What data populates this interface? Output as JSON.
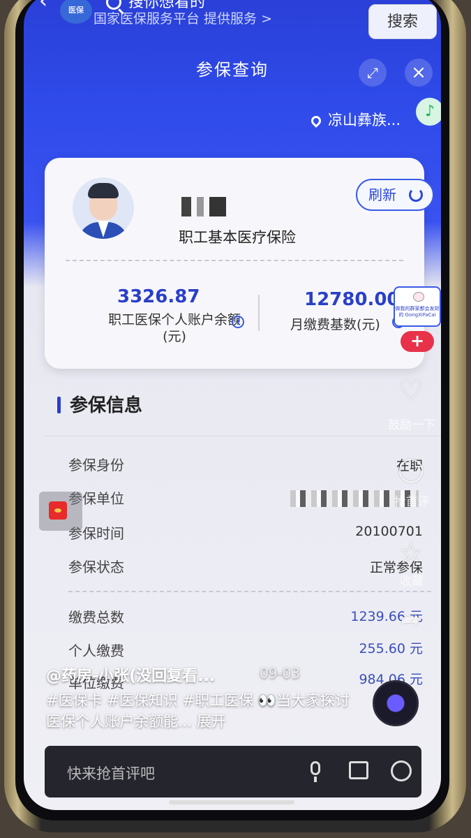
{
  "topbar": {
    "search_placeholder": "搜你想看的",
    "service_text": "国家医保服务平台 提供服务 >",
    "search_button": "搜索",
    "logo_text": "医保"
  },
  "mini_program": {
    "title": "参保查询",
    "location": "凉山彝族..."
  },
  "card": {
    "insurance_type": "职工基本医疗保险",
    "refresh_label": "刷新",
    "balance_value": "3326.87",
    "balance_label": "职工医保个人账户余额(元)",
    "base_value": "12780.00",
    "base_label": "月缴费基数(元)"
  },
  "promo": {
    "text": "做我的群家都会发财的 GongXiFaCai"
  },
  "section": {
    "title": "参保信息",
    "rows": [
      {
        "label": "参保身份",
        "value": "在职"
      },
      {
        "label": "参保单位",
        "value": ""
      },
      {
        "label": "参保时间",
        "value": "20100701"
      },
      {
        "label": "参保状态",
        "value": "正常参保"
      }
    ],
    "payments": [
      {
        "label": "缴费总数",
        "value": "1239.66 元"
      },
      {
        "label": "个人缴费",
        "value": "255.60 元"
      },
      {
        "label": "单位缴费",
        "value": "984.06 元"
      }
    ]
  },
  "overlay": {
    "like_label": "鼓励一下",
    "comment_label": "抢首评",
    "star_label": "收藏",
    "author": "@药房-小张(没回复看...",
    "date": "09-03",
    "caption": "#医保卡 #医保知识 #职工医保 👀当大家探讨医保个人账户余额能... 展开",
    "comment_placeholder": "快来抢首评吧"
  }
}
